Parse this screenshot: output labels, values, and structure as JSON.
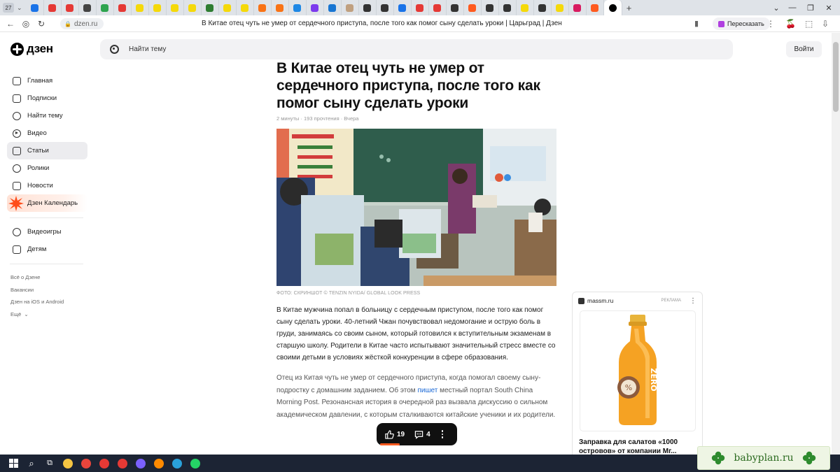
{
  "browser": {
    "tab_count": "27",
    "page_title": "В Китае отец чуть не умер от сердечного приступа, после того как помог сыну сделать уроки | Царьград | Дзен",
    "url": "dzen.ru",
    "retell_label": "Пересказать",
    "pinned_tab_colors": [
      "#1a73e8",
      "#e53935",
      "#e53935",
      "#444444",
      "#2ea44f",
      "#e53935",
      "#f5d90a",
      "#f5d90a",
      "#f5d90a",
      "#f5d90a",
      "#2e7d32",
      "#f5d90a",
      "#f5d90a",
      "#f97316",
      "#f97316",
      "#1e88e5",
      "#7c3aed",
      "#1976d2",
      "#c0a080",
      "#333333",
      "#333333",
      "#1a73e8",
      "#e53935",
      "#e53935",
      "#333333",
      "#ff5a1f",
      "#333333",
      "#333333",
      "#f5d90a",
      "#333333",
      "#f5d90a",
      "#d81b60",
      "#ff5a1f"
    ]
  },
  "header": {
    "logo_text": "дзен",
    "search_placeholder": "Найти тему",
    "login_label": "Войти"
  },
  "sidebar": {
    "items": [
      {
        "label": "Главная",
        "icon": "home-icon"
      },
      {
        "label": "Подписки",
        "icon": "subscriptions-icon"
      },
      {
        "label": "Найти тему",
        "icon": "compass-icon"
      },
      {
        "label": "Видео",
        "icon": "video-icon"
      },
      {
        "label": "Статьи",
        "icon": "articles-icon",
        "active": true
      },
      {
        "label": "Ролики",
        "icon": "shorts-icon"
      },
      {
        "label": "Новости",
        "icon": "news-icon"
      },
      {
        "label": "Дзен Календарь",
        "icon": "calendar-burst-icon"
      }
    ],
    "extra_items": [
      {
        "label": "Видеоигры",
        "icon": "gamepad-icon"
      },
      {
        "label": "Детям",
        "icon": "kids-icon"
      }
    ],
    "footer_links": [
      "Всё о Дзене",
      "Вакансии",
      "Дзен на iOS и Android",
      "Ещё"
    ]
  },
  "article": {
    "title": "В Китае отец чуть не умер от сердечного приступа, после того как помог сыну сделать уроки",
    "meta": "2 минуты · 193 прочтения · Вчера",
    "photo_caption": "ФОТО: СКРИНШОТ © TENZIN NYIDA/ GLOBAL LOOK PRESS",
    "lead": "В Китае мужчина попал в больницу с сердечным приступом, после того как помог сыну сделать уроки. 40-летний Чжан почувствовал недомогание и острую боль в груди, занимаясь со своим сыном, который готовился к вступительным экзаменам в старшую школу. Родители в Китае часто испытывают значительный стресс вместе со своими детьми в условиях жёсткой конкуренции в сфере образования.",
    "body_before_link": "Отец из Китая чуть не умер от сердечного приступа, когда помогал своему сыну-подростку с домашним заданием. Об этом ",
    "body_link": "пишет",
    "body_after_link": " местный портал South China Morning Post. Резонансная история в очередной раз вызвала дискуссию о сильном академическом давлении, с которым сталкиваются китайские ученики и их родители.",
    "likes": "19",
    "comments": "4",
    "read_progress": 0.07
  },
  "ad": {
    "advertiser": "massm.ru",
    "tag": "РЕКЛАМА",
    "title": "Заправка для салатов «1000 островов» от компании Мг..."
  },
  "watermark": {
    "text": "babyplan.ru"
  },
  "taskbar_icon_colors": [
    "#ffffff",
    "#ffffff",
    "#ffffff",
    "#f5c542",
    "#e8453c",
    "#e53935",
    "#e53935",
    "#7b61ff",
    "#ff8a00",
    "#2aa1da",
    "#25d366"
  ]
}
